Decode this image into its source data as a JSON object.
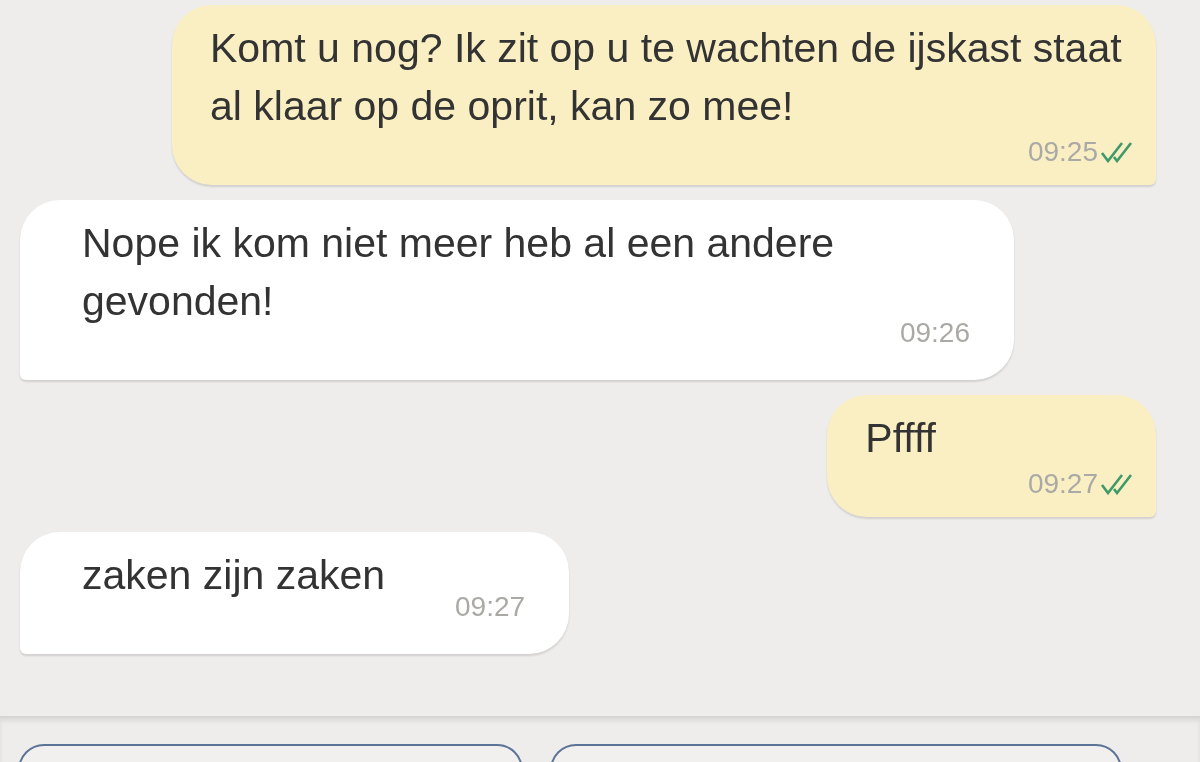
{
  "messages": [
    {
      "kind": "outgoing",
      "text": "Komt u nog? Ik zit op u te wachten de ijskast staat al klaar op de oprit, kan zo mee!",
      "time": "09:25",
      "read": true
    },
    {
      "kind": "incoming",
      "text": "Nope ik kom niet meer heb al een andere gevonden!",
      "time": "09:26"
    },
    {
      "kind": "outgoing",
      "text": "Pffff",
      "time": "09:27",
      "read": true
    },
    {
      "kind": "incoming",
      "text": "zaken zijn zaken",
      "time": "09:27"
    }
  ]
}
